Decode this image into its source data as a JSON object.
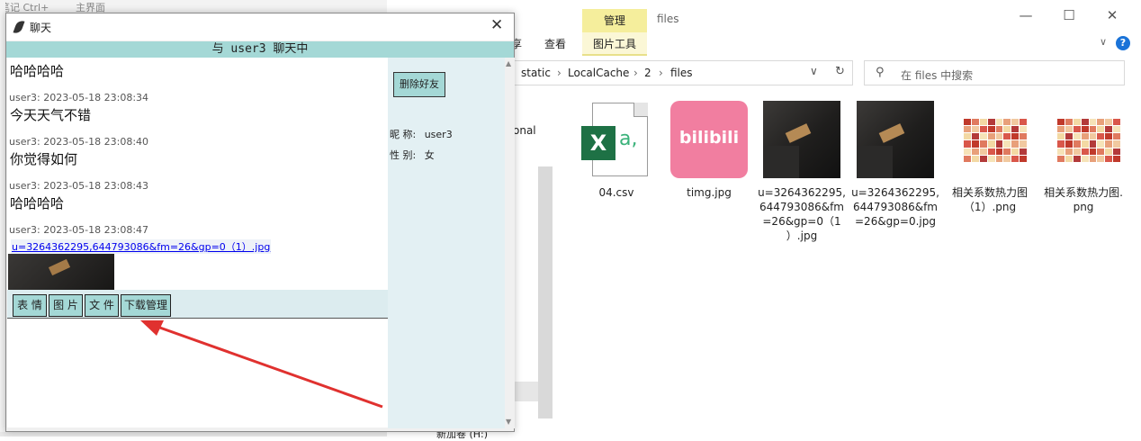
{
  "background": {
    "top_left_fragment": "笔记 Ctrl+",
    "top_main_fragment": "主界面",
    "nav_bottom_fragment": "新加卷 (H:)"
  },
  "explorer": {
    "ribbon": {
      "manage_tab": "管理",
      "picture_tools_tab": "图片工具",
      "view_tab": "查看",
      "share_fragment": "享",
      "window_title": "files"
    },
    "window_controls": {
      "minimize": "—",
      "maximize": "☐",
      "close": "✕"
    },
    "breadcrumb": [
      "static",
      "LocalCache",
      "2",
      "files"
    ],
    "breadcrumb_sep": "›",
    "search_placeholder": "在 files 中搜索",
    "nav_fragment": "onal",
    "files": [
      {
        "name": "04.csv",
        "icon": "excel-csv-icon"
      },
      {
        "name": "timg.jpg",
        "icon": "bilibili-image"
      },
      {
        "name": "u=3264362295,644793086&fm=26&gp=0（1）.jpg",
        "icon": "photo-thumbnail"
      },
      {
        "name": "u=3264362295,644793086&fm=26&gp=0.jpg",
        "icon": "photo-thumbnail"
      },
      {
        "name": "相关系数热力图（1）.png",
        "icon": "heatmap-thumbnail"
      },
      {
        "name": "相关系数热力图.png",
        "icon": "heatmap-thumbnail"
      }
    ],
    "file_label_lines": [
      [
        "04.csv"
      ],
      [
        "timg.jpg"
      ],
      [
        "u=3264362295,",
        "644793086&fm",
        "=26&gp=0（1",
        "）.jpg"
      ],
      [
        "u=3264362295,",
        "644793086&fm",
        "=26&gp=0.jpg"
      ],
      [
        "相关系数热力图",
        "（1）.png"
      ],
      [
        "相关系数热力图.",
        "png"
      ]
    ],
    "bili_text": "bilibili"
  },
  "chat": {
    "window_title": "聊天",
    "header": "与 user3 聊天中",
    "messages": [
      {
        "meta": "",
        "text": "哈哈哈哈"
      },
      {
        "meta": "user3: 2023-05-18 23:08:34",
        "text": "今天天气不错"
      },
      {
        "meta": "user3: 2023-05-18 23:08:40",
        "text": "你觉得如何"
      },
      {
        "meta": "user3: 2023-05-18 23:08:43",
        "text": "哈哈哈哈"
      },
      {
        "meta": "user3: 2023-05-18 23:08:47",
        "text": ""
      }
    ],
    "file_link": "u=3264362295,644793086&fm=26&gp=0（1）.jpg",
    "toolbar": {
      "emoji": "表 情",
      "image": "图 片",
      "file": "文 件",
      "download": "下载管理"
    },
    "side": {
      "delete_friend": "删除好友",
      "nickname_label": "昵 称:",
      "nickname_value": "user3",
      "gender_label": "性 别:",
      "gender_value": "女"
    }
  },
  "colors": {
    "chat_accent": "#a4d8d6",
    "side_panel": "#e3f0f3",
    "annotation_arrow": "#e0312f",
    "ribbon_manage": "#f5ee9c",
    "link": "#0000ee"
  }
}
